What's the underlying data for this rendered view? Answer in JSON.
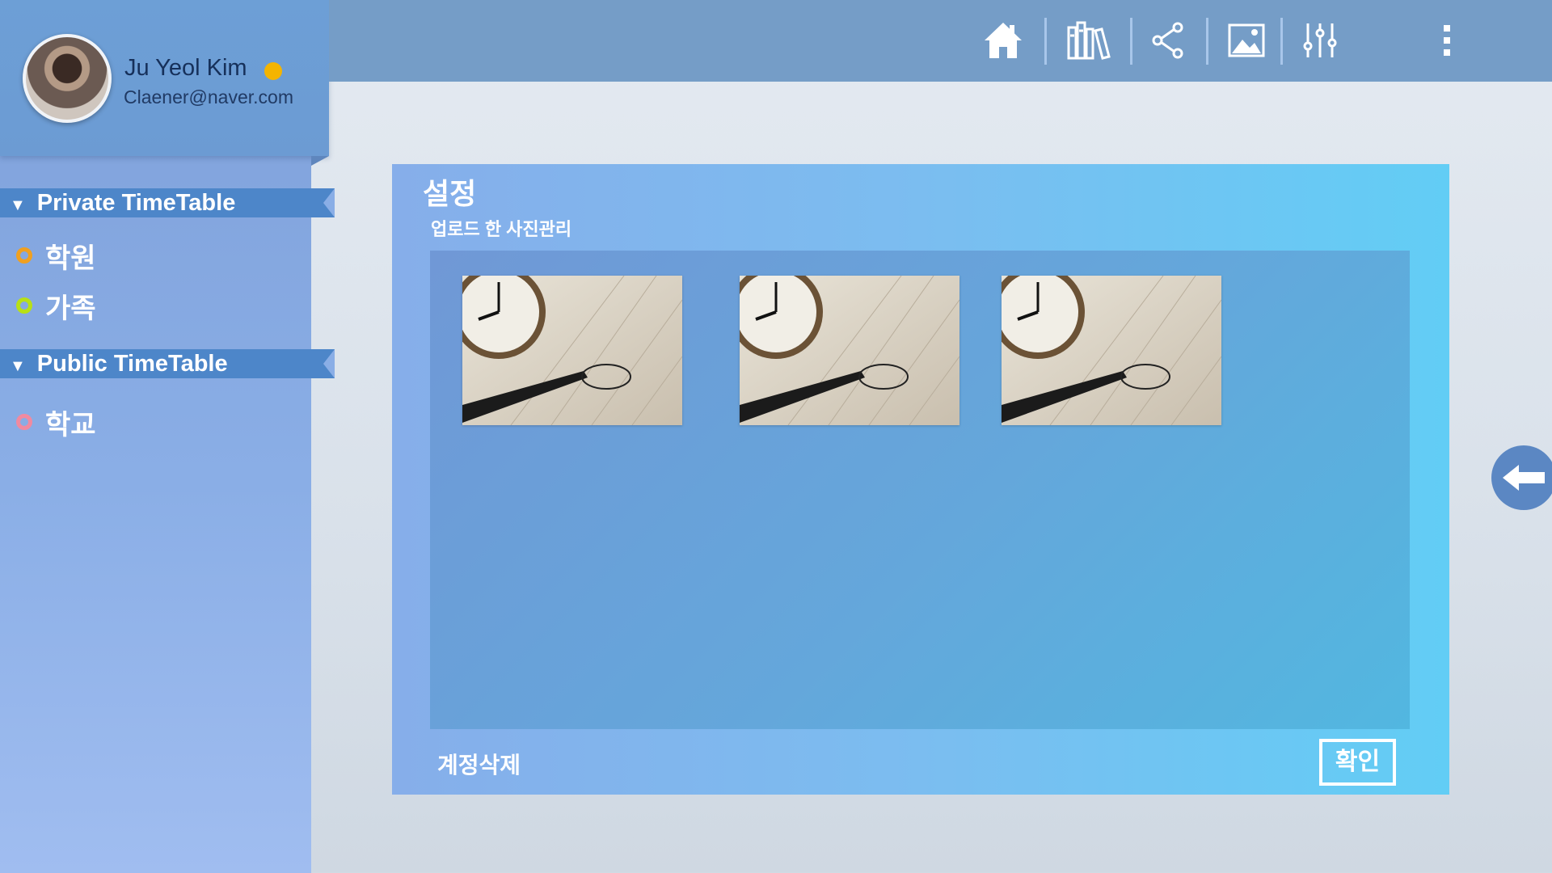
{
  "user": {
    "name": "Ju Yeol Kim",
    "email": "Claener@naver.com",
    "status_color": "#f4b400"
  },
  "sidebar": {
    "sections": [
      {
        "title": "Private TimeTable",
        "items": [
          {
            "label": "학원",
            "color": "#f0a020"
          },
          {
            "label": "가족",
            "color": "#b8e016"
          }
        ]
      },
      {
        "title": "Public TimeTable",
        "items": [
          {
            "label": "학교",
            "color": "#f08aa0"
          }
        ]
      }
    ]
  },
  "toolbar": {
    "icons": [
      "home-icon",
      "library-icon",
      "share-icon",
      "image-icon",
      "sliders-icon",
      "more-vertical-icon"
    ]
  },
  "settings": {
    "title": "설정",
    "subtitle": "업로드 한 사진관리",
    "photos": [
      {
        "icon": "clock-calendar-photo"
      },
      {
        "icon": "clock-calendar-photo"
      },
      {
        "icon": "clock-calendar-photo"
      }
    ],
    "delete_account_label": "계정삭제",
    "confirm_label": "확인"
  },
  "navigation": {
    "back_icon": "arrow-left-icon"
  }
}
